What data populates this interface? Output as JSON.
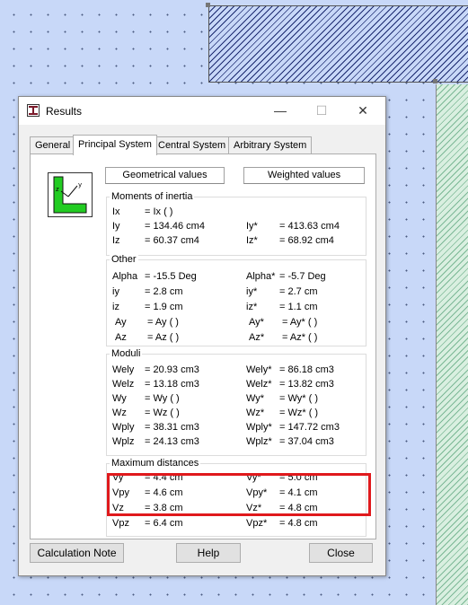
{
  "window": {
    "title": "Results",
    "minimize": "—",
    "maximize": "☐",
    "close": "✕"
  },
  "tabs": [
    "General",
    "Principal System",
    "Central System",
    "Arbitrary System"
  ],
  "active_tab": "Principal System",
  "section_headers": {
    "geometric": "Geometrical values",
    "weighted": "Weighted values"
  },
  "groups": {
    "inertia": {
      "title": "Moments of inertia",
      "rows": [
        {
          "n": "Ix",
          "v": "= Ix ( )",
          "wn": "",
          "wv": ""
        },
        {
          "n": "Iy",
          "v": "= 134.46 cm4",
          "wn": "Iy*",
          "wv": "= 413.63 cm4"
        },
        {
          "n": "Iz",
          "v": "= 60.37 cm4",
          "wn": "Iz*",
          "wv": "= 68.92 cm4"
        }
      ]
    },
    "other": {
      "title": "Other",
      "rows": [
        {
          "n": "Alpha",
          "v": "= -15.5 Deg",
          "wn": "Alpha*",
          "wv": "= -5.7 Deg"
        },
        {
          "n": "iy",
          "v": "= 2.8 cm",
          "wn": "iy*",
          "wv": "= 2.7 cm"
        },
        {
          "n": "iz",
          "v": "= 1.9 cm",
          "wn": "iz*",
          "wv": "= 1.1 cm"
        },
        {
          "n": "Ay",
          "v": "= Ay ( )",
          "wn": "Ay*",
          "wv": "= Ay* ( )"
        },
        {
          "n": "Az",
          "v": "= Az ( )",
          "wn": "Az*",
          "wv": "= Az* ( )"
        }
      ]
    },
    "moduli": {
      "title": "Moduli",
      "rows": [
        {
          "n": "Wely",
          "v": "= 20.93 cm3",
          "wn": "Wely*",
          "wv": "= 86.18 cm3"
        },
        {
          "n": "Welz",
          "v": "= 13.18 cm3",
          "wn": "Welz*",
          "wv": "= 13.82 cm3"
        },
        {
          "n": "Wy",
          "v": "= Wy ( )",
          "wn": "Wy*",
          "wv": "= Wy* ( )"
        },
        {
          "n": "Wz",
          "v": "= Wz ( )",
          "wn": "Wz*",
          "wv": "= Wz* ( )"
        },
        {
          "n": "Wply",
          "v": "= 38.31 cm3",
          "wn": "Wply*",
          "wv": "= 147.72 cm3"
        },
        {
          "n": "Wplz",
          "v": "= 24.13 cm3",
          "wn": "Wplz*",
          "wv": "= 37.04 cm3"
        }
      ]
    },
    "distances": {
      "title": "Maximum distances",
      "rows": [
        {
          "n": "Vy",
          "v": "= 4.4 cm",
          "wn": "Vy*",
          "wv": "= 5.0 cm"
        },
        {
          "n": "Vpy",
          "v": "= 4.6 cm",
          "wn": "Vpy*",
          "wv": "= 4.1 cm"
        },
        {
          "n": "Vz",
          "v": "= 3.8 cm",
          "wn": "Vz*",
          "wv": "= 4.8 cm"
        },
        {
          "n": "Vpz",
          "v": "= 6.4 cm",
          "wn": "Vpz*",
          "wv": "= 4.8 cm"
        }
      ]
    }
  },
  "buttons": {
    "calc_note": "Calculation Note",
    "help": "Help",
    "close": "Close"
  },
  "icon_labels": {
    "z": "z",
    "y": "y"
  },
  "colors": {
    "highlight": "#e0191c",
    "section_icon_fill": "#22cc22"
  }
}
